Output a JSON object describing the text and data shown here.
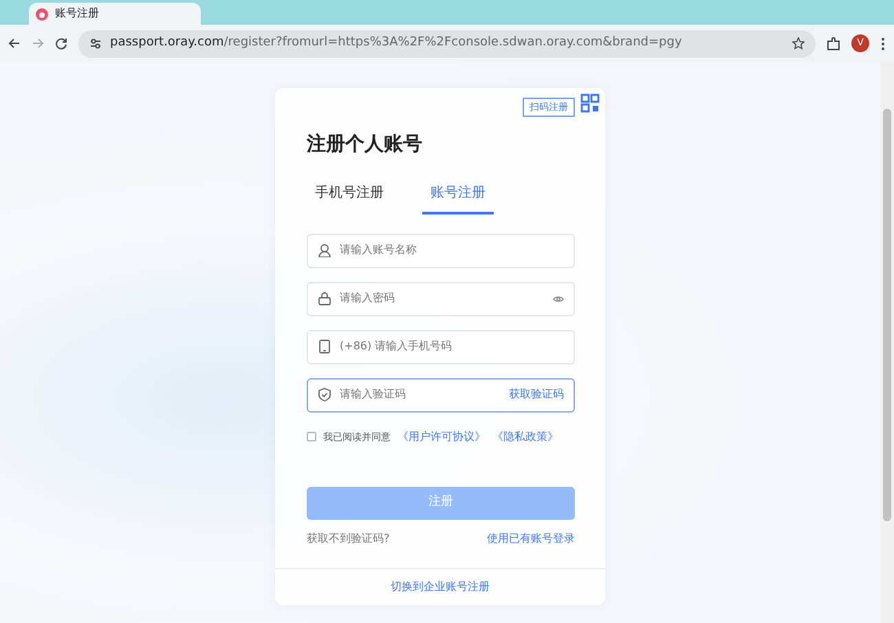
{
  "browser": {
    "tab_title": "账号注册",
    "url_host": "passport.oray.com",
    "url_path": "/register?fromurl=https%3A%2F%2Fconsole.sdwan.oray.com&brand=pgy",
    "avatar_letter": "V"
  },
  "card": {
    "qr_badge": "扫码注册",
    "title": "注册个人账号",
    "tabs": [
      {
        "label": "手机号注册",
        "selected": false
      },
      {
        "label": "账号注册",
        "selected": true
      }
    ],
    "fields": [
      {
        "kind": "account",
        "placeholder": "请输入账号名称",
        "focused": false
      },
      {
        "kind": "password",
        "placeholder": "请输入密码",
        "focused": false
      },
      {
        "kind": "phone",
        "placeholder": "(+86) 请输入手机号码",
        "focused": false
      },
      {
        "kind": "code",
        "placeholder": "请输入验证码",
        "focused": true,
        "action": "获取验证码"
      }
    ],
    "agreement": {
      "checked": false,
      "text": "我已阅读并同意",
      "links": [
        "《用户许可协议》",
        "《隐私政策》"
      ]
    },
    "submit": {
      "label": "注册",
      "disabled": true
    },
    "help_link": "获取不到验证码?",
    "login_link": "使用已有账号登录",
    "footer_link": "切换到企业账号注册"
  }
}
